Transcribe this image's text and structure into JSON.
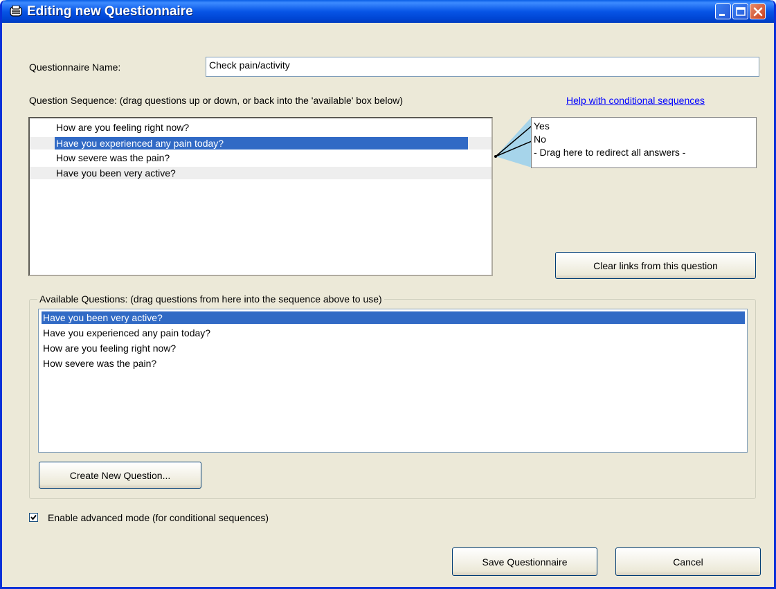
{
  "window": {
    "title": "Editing new Questionnaire",
    "icons": [
      "app-icon",
      "minimize-icon",
      "maximize-icon",
      "close-icon"
    ]
  },
  "form": {
    "name_label": "Questionnaire Name:",
    "name_value": "Check pain/activity",
    "sequence_label": "Question Sequence: (drag questions up or down, or back into the 'available' box below)",
    "help_link": "Help with conditional sequences"
  },
  "sequence": {
    "items": [
      "How are you feeling right now?",
      "Have you experienced any pain today?",
      "How severe was the pain?",
      "Have you been very active?"
    ],
    "selected_index": 1
  },
  "answers": {
    "items": [
      "Yes",
      "No",
      "- Drag here to redirect all answers -"
    ]
  },
  "clear_links_button": "Clear links from this question",
  "available": {
    "caption": "Available Questions: (drag questions from here into the sequence above to use)",
    "items": [
      "Have you been very active?",
      "Have you experienced any pain today?",
      "How are you feeling right now?",
      "How severe was the pain?"
    ],
    "selected_index": 0
  },
  "create_button": "Create New Question...",
  "advanced_mode": {
    "label": "Enable advanced mode (for conditional sequences)",
    "checked": true
  },
  "footer": {
    "save_button": "Save Questionnaire",
    "cancel_button": "Cancel"
  },
  "colors": {
    "titlebar": "#0054e3",
    "selection": "#316ac5",
    "dialog_bg": "#ece9d8",
    "link": "#0000ff"
  }
}
